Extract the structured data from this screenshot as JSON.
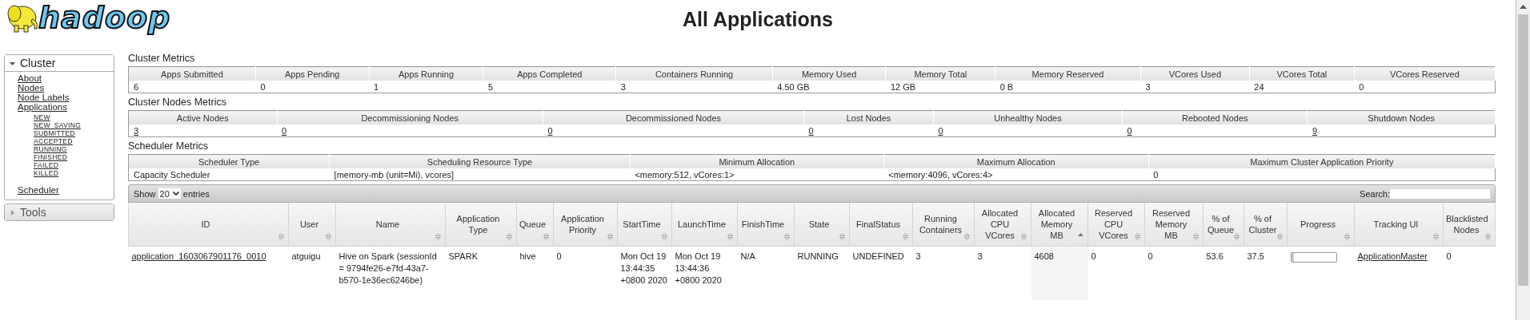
{
  "logo": {
    "text": "hadoop"
  },
  "title": "All Applications",
  "sidebar": {
    "sections": [
      {
        "label": "Cluster",
        "expanded": true,
        "items": [
          {
            "label": "About"
          },
          {
            "label": "Nodes"
          },
          {
            "label": "Node Labels"
          },
          {
            "label": "Applications",
            "children": [
              {
                "label": "NEW"
              },
              {
                "label": "NEW_SAVING"
              },
              {
                "label": "SUBMITTED"
              },
              {
                "label": "ACCEPTED"
              },
              {
                "label": "RUNNING"
              },
              {
                "label": "FINISHED"
              },
              {
                "label": "FAILED"
              },
              {
                "label": "KILLED"
              }
            ]
          },
          {
            "label": "Scheduler"
          }
        ]
      },
      {
        "label": "Tools",
        "expanded": false
      }
    ]
  },
  "metrics": [
    {
      "title": "Cluster Metrics",
      "linked": false,
      "columns": [
        "Apps Submitted",
        "Apps Pending",
        "Apps Running",
        "Apps Completed",
        "Containers Running",
        "Memory Used",
        "Memory Total",
        "Memory Reserved",
        "VCores Used",
        "VCores Total",
        "VCores Reserved"
      ],
      "values": [
        "6",
        "0",
        "1",
        "5",
        "3",
        "4.50 GB",
        "12 GB",
        "0 B",
        "3",
        "24",
        "0"
      ]
    },
    {
      "title": "Cluster Nodes Metrics",
      "linked": true,
      "columns": [
        "Active Nodes",
        "Decommissioning Nodes",
        "Decommissioned Nodes",
        "Lost Nodes",
        "Unhealthy Nodes",
        "Rebooted Nodes",
        "Shutdown Nodes"
      ],
      "values": [
        "3",
        "0",
        "0",
        "0",
        "0",
        "0",
        "9"
      ]
    },
    {
      "title": "Scheduler Metrics",
      "linked": false,
      "columns": [
        "Scheduler Type",
        "Scheduling Resource Type",
        "Minimum Allocation",
        "Maximum Allocation",
        "Maximum Cluster Application Priority"
      ],
      "values": [
        "Capacity Scheduler",
        "[memory-mb (unit=Mi), vcores]",
        "<memory:512, vCores:1>",
        "<memory:4096, vCores:4>",
        "0"
      ]
    }
  ],
  "applications": {
    "show_entries": {
      "before": "Show",
      "value": "20",
      "after": "entries"
    },
    "search": {
      "label": "Search:"
    },
    "columns": [
      {
        "label": "ID",
        "kind": "link",
        "sorted": false
      },
      {
        "label": "User",
        "kind": "text",
        "sorted": false
      },
      {
        "label": "Name",
        "kind": "text",
        "sorted": false
      },
      {
        "label": "Application Type",
        "kind": "text",
        "sorted": false
      },
      {
        "label": "Queue",
        "kind": "text",
        "sorted": false
      },
      {
        "label": "Application Priority",
        "kind": "text",
        "sorted": false
      },
      {
        "label": "StartTime",
        "kind": "text",
        "sorted": false
      },
      {
        "label": "LaunchTime",
        "kind": "text",
        "sorted": false
      },
      {
        "label": "FinishTime",
        "kind": "text",
        "sorted": false
      },
      {
        "label": "State",
        "kind": "text",
        "sorted": false
      },
      {
        "label": "FinalStatus",
        "kind": "text",
        "sorted": false
      },
      {
        "label": "Running Containers",
        "kind": "text",
        "sorted": false
      },
      {
        "label": "Allocated CPU VCores",
        "kind": "text",
        "sorted": false
      },
      {
        "label": "Allocated Memory MB",
        "kind": "text",
        "sorted": true
      },
      {
        "label": "Reserved CPU VCores",
        "kind": "text",
        "sorted": false
      },
      {
        "label": "Reserved Memory MB",
        "kind": "text",
        "sorted": false
      },
      {
        "label": "% of Queue",
        "kind": "text",
        "sorted": false
      },
      {
        "label": "% of Cluster",
        "kind": "text",
        "sorted": false
      },
      {
        "label": "Progress",
        "kind": "progress",
        "sorted": false
      },
      {
        "label": "Tracking UI",
        "kind": "link",
        "sorted": false
      },
      {
        "label": "Blacklisted Nodes",
        "kind": "text",
        "sorted": false
      }
    ],
    "rows": [
      {
        "cells": [
          "application_1603067901176_0010",
          "atguigu",
          "Hive on Spark (sessionId = 9794fe26-e7fd-43a7-b570-1e36ec6246be)",
          "SPARK",
          "hive",
          "0",
          "Mon Oct 19 13:44:35 +0800 2020",
          "Mon Oct 19 13:44:36 +0800 2020",
          "N/A",
          "RUNNING",
          "UNDEFINED",
          "3",
          "3",
          "4608",
          "0",
          "0",
          "53.6",
          "37.5",
          {
            "level": 0.06
          },
          "ApplicationMaster",
          "0"
        ]
      }
    ]
  }
}
